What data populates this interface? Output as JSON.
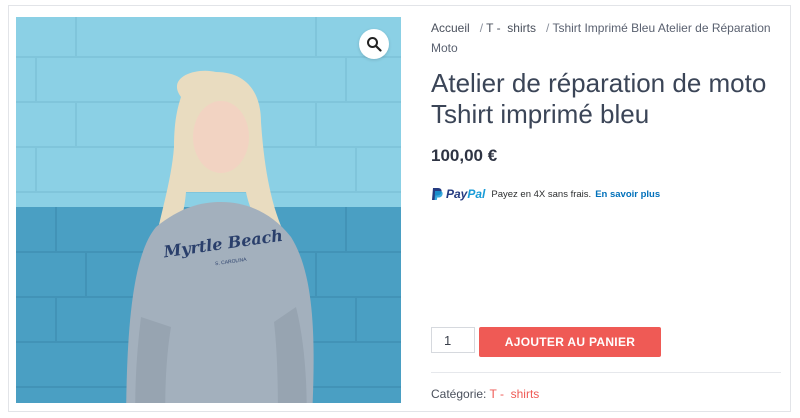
{
  "breadcrumb": {
    "home": "Accueil",
    "category_part1": "T -",
    "category_part2": "shirts",
    "current": "Tshirt Imprimé Bleu Atelier de Réparation Moto",
    "separator": "/"
  },
  "product": {
    "title": "Atelier de réparation de moto Tshirt imprimé bleu",
    "price": "100,00 €",
    "image_alt_text": "Myrtle Beach",
    "image_alt_subtext": "S. CAROLINA"
  },
  "paypal": {
    "brand_pay": "Pay",
    "brand_pal": "Pal",
    "message": "Payez en 4X sans frais.",
    "learn_more": "En savoir plus"
  },
  "cart": {
    "quantity": "1",
    "add_button": "AJOUTER AU PANIER"
  },
  "meta": {
    "category_label": "Catégorie:",
    "category_part1": "T -",
    "category_part2": "shirts"
  },
  "colors": {
    "accent": "#ef5a55",
    "paypal_blue": "#253b80",
    "paypal_light": "#179bd7"
  },
  "icons": {
    "zoom": "magnifier-icon",
    "paypal": "paypal-logo-icon"
  }
}
